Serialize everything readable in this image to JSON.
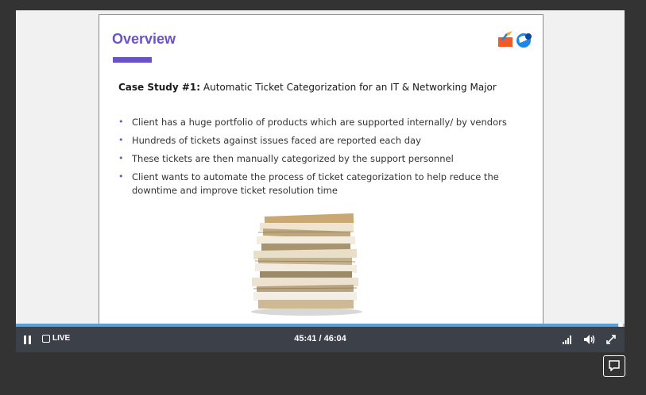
{
  "slide": {
    "title": "Overview",
    "case_label": "Case Study #1:",
    "case_text": " Automatic Ticket Categorization for an IT & Networking Major",
    "bullets": [
      "Client has a huge portfolio of products which are supported internally/ by vendors",
      "Hundreds of tickets against issues faced are reported each day",
      "These tickets are then manually categorized by the support personnel",
      "Client wants to automate the process of ticket categorization to help reduce the downtime and improve ticket resolution time"
    ],
    "bullet_glyph": "•",
    "accent_color": "#6a52c8"
  },
  "player": {
    "live_label": "LIVE",
    "time_current": "45:41",
    "time_sep": " / ",
    "time_total": "46:04",
    "progress_fraction": 0.993,
    "progress_color": "#5aa0d8"
  },
  "icons": {
    "pause": "pause-icon",
    "live": "live-indicator-icon",
    "quality": "signal-bars-icon",
    "volume": "volume-icon",
    "fullscreen": "fullscreen-icon",
    "chat": "chat-bubble-icon",
    "logo_left": "brand-logo-orange-icon",
    "logo_right": "brand-logo-blue-icon"
  }
}
